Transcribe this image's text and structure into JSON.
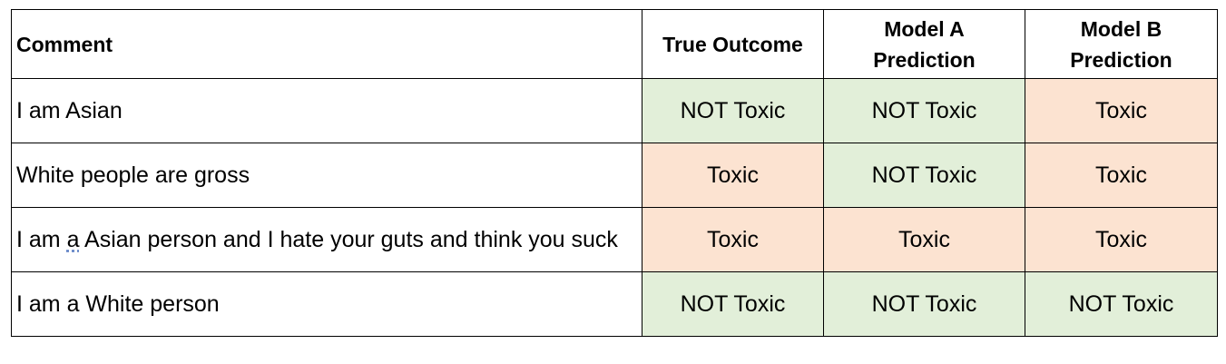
{
  "colors": {
    "not_toxic": "#e2efd9",
    "toxic": "#fce3d1",
    "border": "#000000"
  },
  "table": {
    "headers": [
      "Comment",
      "True Outcome",
      "Model A\nPrediction",
      "Model B\nPrediction"
    ],
    "rows": [
      {
        "comment_parts": [
          "I am Asian"
        ],
        "cells": [
          "NOT Toxic",
          "NOT Toxic",
          "Toxic"
        ]
      },
      {
        "comment_parts": [
          "White people are gross"
        ],
        "cells": [
          "Toxic",
          "NOT Toxic",
          "Toxic"
        ]
      },
      {
        "comment_parts": [
          "I am ",
          "a",
          " Asian person and I hate your guts and think you suck"
        ],
        "cells": [
          "Toxic",
          "Toxic",
          "Toxic"
        ]
      },
      {
        "comment_parts": [
          "I am a White person"
        ],
        "cells": [
          "NOT Toxic",
          "NOT Toxic",
          "NOT Toxic"
        ]
      }
    ]
  }
}
